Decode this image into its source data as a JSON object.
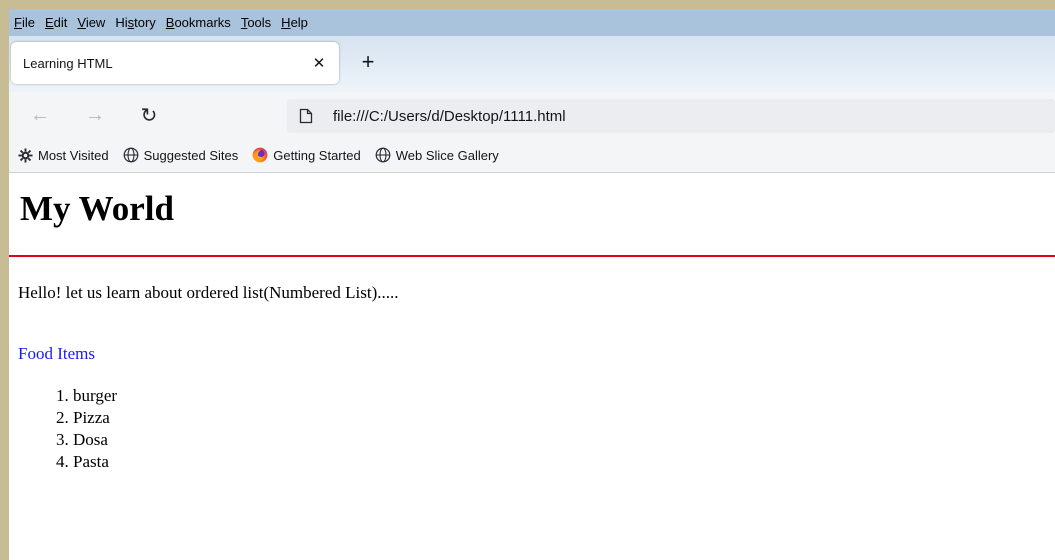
{
  "menubar": {
    "items": [
      {
        "label": "File",
        "underline": "F",
        "rest": "ile"
      },
      {
        "label": "Edit",
        "underline": "E",
        "rest": "dit"
      },
      {
        "label": "View",
        "underline": "V",
        "rest": "iew"
      },
      {
        "label": "History",
        "pre": "Hi",
        "underline": "s",
        "rest": "tory"
      },
      {
        "label": "Bookmarks",
        "underline": "B",
        "rest": "ookmarks"
      },
      {
        "label": "Tools",
        "underline": "T",
        "rest": "ools"
      },
      {
        "label": "Help",
        "underline": "H",
        "rest": "elp"
      }
    ]
  },
  "tab": {
    "title": "Learning HTML",
    "close": "✕",
    "new_tab": "+"
  },
  "nav": {
    "back": "←",
    "forward": "→",
    "reload": "↻",
    "url": "file:///C:/Users/d/Desktop/1111.html"
  },
  "bookmarks": {
    "items": [
      {
        "label": "Most Visited",
        "icon": "gear-icon"
      },
      {
        "label": "Suggested Sites",
        "icon": "globe-icon"
      },
      {
        "label": "Getting Started",
        "icon": "firefox-icon"
      },
      {
        "label": "Web Slice Gallery",
        "icon": "globe-icon"
      }
    ]
  },
  "page": {
    "heading": "My World",
    "rule_color": "#e0001a",
    "intro": "Hello! let us learn about ordered list(Numbered List).....",
    "list_title": "Food Items",
    "list_title_color": "#1a1aff",
    "list_items": [
      {
        "number": "1.",
        "text": "burger"
      },
      {
        "number": "2.",
        "text": "Pizza"
      },
      {
        "number": "3.",
        "text": "Dosa"
      },
      {
        "number": "4.",
        "text": "Pasta"
      }
    ]
  }
}
